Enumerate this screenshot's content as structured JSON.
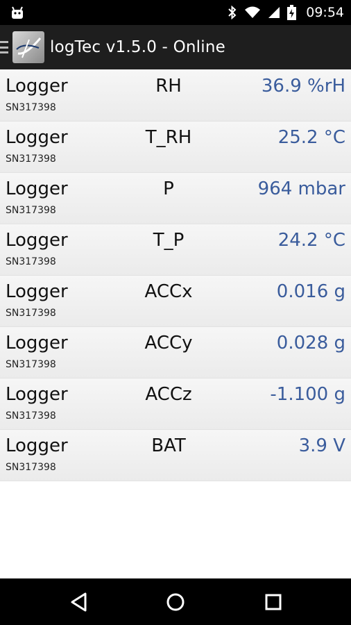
{
  "status_bar": {
    "time": "09:54",
    "icons": [
      "android-icon",
      "bluetooth-icon",
      "wifi-icon",
      "signal-icon",
      "battery-charging-icon"
    ]
  },
  "action_bar": {
    "title": "logTec v1.5.0 - Online",
    "logo_icon": "logtec-logo-icon",
    "drawer_icon": "drawer-menu-icon"
  },
  "rows": [
    {
      "device": "Logger",
      "serial": "SN317398",
      "channel": "RH",
      "value": "36.9 %rH"
    },
    {
      "device": "Logger",
      "serial": "SN317398",
      "channel": "T_RH",
      "value": "25.2 °C"
    },
    {
      "device": "Logger",
      "serial": "SN317398",
      "channel": "P",
      "value": "964 mbar"
    },
    {
      "device": "Logger",
      "serial": "SN317398",
      "channel": "T_P",
      "value": "24.2 °C"
    },
    {
      "device": "Logger",
      "serial": "SN317398",
      "channel": "ACCx",
      "value": "0.016 g"
    },
    {
      "device": "Logger",
      "serial": "SN317398",
      "channel": "ACCy",
      "value": "0.028 g"
    },
    {
      "device": "Logger",
      "serial": "SN317398",
      "channel": "ACCz",
      "value": "-1.100 g"
    },
    {
      "device": "Logger",
      "serial": "SN317398",
      "channel": "BAT",
      "value": "3.9 V"
    }
  ],
  "nav_bar": {
    "buttons": [
      "back-icon",
      "home-icon",
      "recents-icon"
    ]
  },
  "colors": {
    "value_text": "#3a5c9c",
    "action_bar": "#1e1e1e",
    "status_bar": "#000000"
  }
}
